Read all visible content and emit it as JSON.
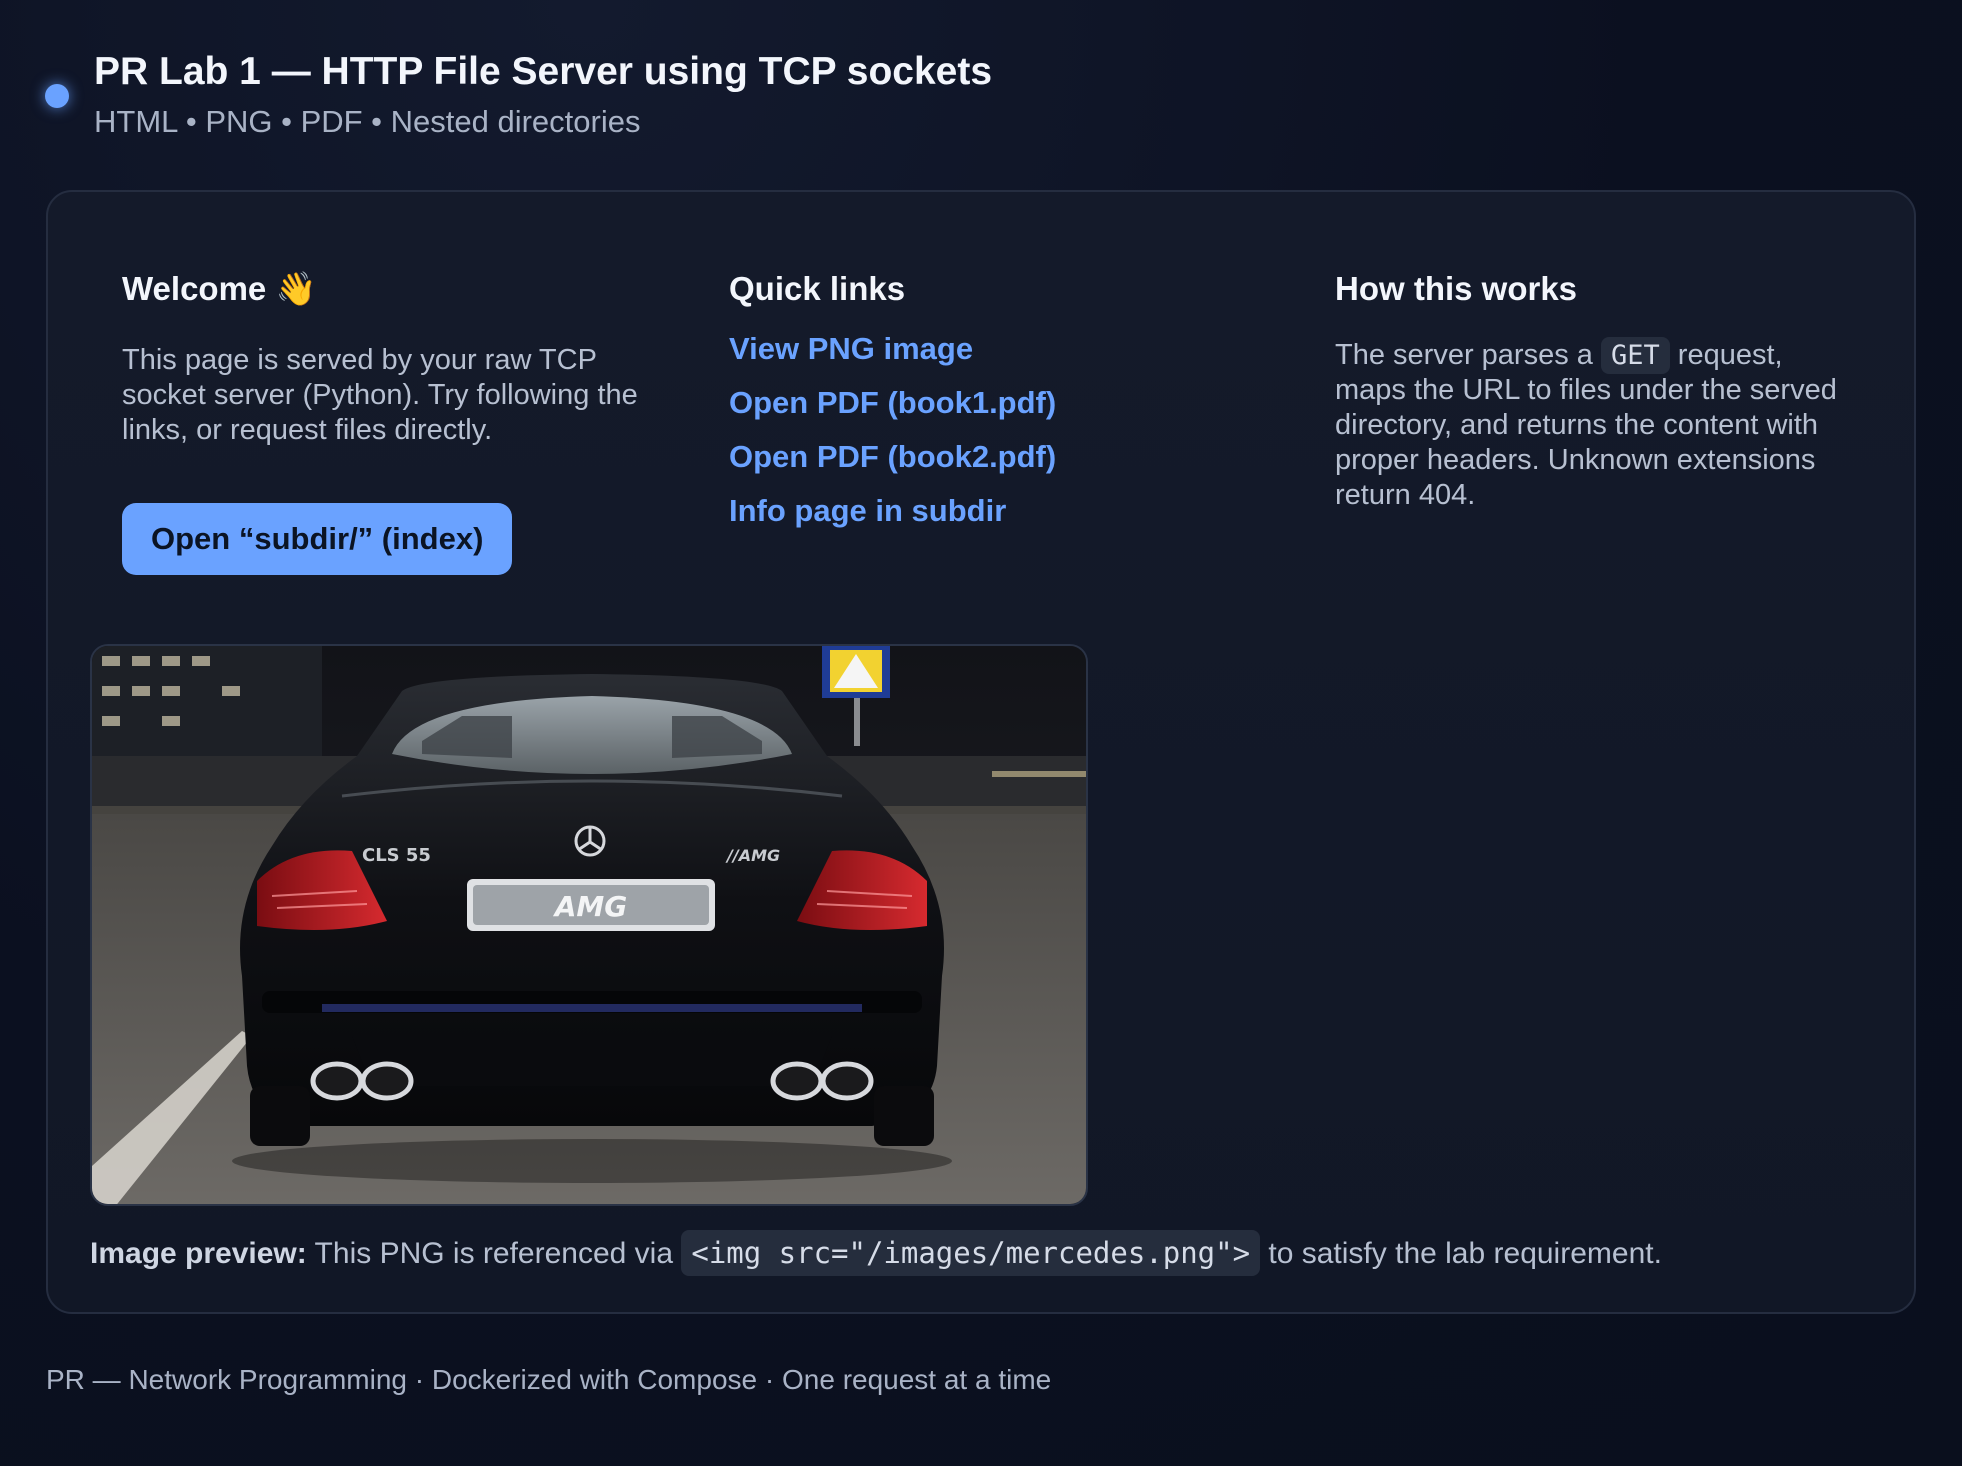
{
  "header": {
    "title": "PR Lab 1 — HTTP File Server using TCP sockets",
    "subtitle": "HTML • PNG • PDF • Nested directories"
  },
  "welcome": {
    "heading": "Welcome 👋",
    "text": "This page is served by your raw TCP socket server (Python). Try following the links, or request files directly.",
    "button_label": "Open “subdir/” (index)"
  },
  "quick_links": {
    "heading": "Quick links",
    "items": [
      {
        "label": "View PNG image"
      },
      {
        "label": "Open PDF (book1.pdf)"
      },
      {
        "label": "Open PDF (book2.pdf)"
      },
      {
        "label": "Info page in subdir"
      }
    ]
  },
  "how": {
    "heading": "How this works",
    "text_before": "The server parses a ",
    "code": "GET",
    "text_after": " request, maps the URL to files under the served directory, and returns the content with proper headers. Unknown extensions return 404."
  },
  "preview": {
    "image_alt": "Rear view of a black Mercedes CLS sedan",
    "badge_text": "AMG",
    "caption_label": "Image preview:",
    "caption_before": " This PNG is referenced via ",
    "caption_code": "<img src=\"/images/mercedes.png\">",
    "caption_after": " to satisfy the lab requirement."
  },
  "footer": {
    "text": "PR — Network Programming · Dockerized with Compose · One request at a time"
  },
  "colors": {
    "accent": "#6aa2ff",
    "background": "#0b1020",
    "card": "#141a2a"
  }
}
